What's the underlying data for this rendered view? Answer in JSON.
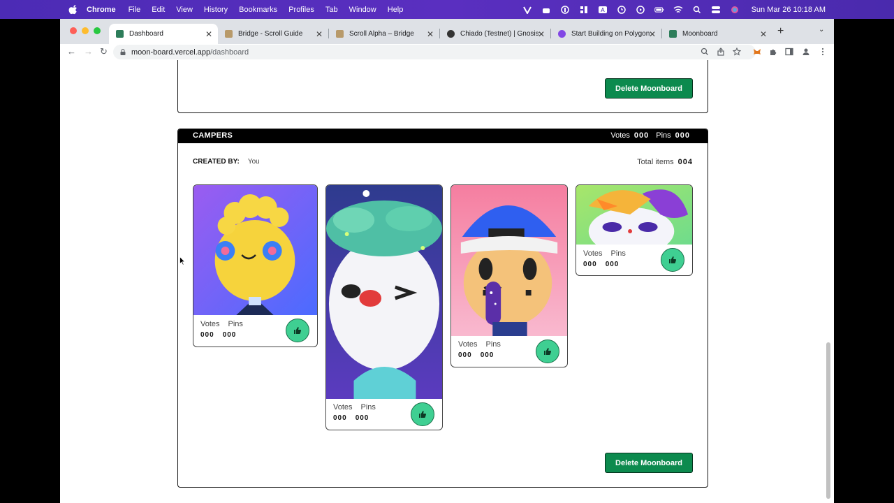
{
  "menubar": {
    "app": "Chrome",
    "items": [
      "File",
      "Edit",
      "View",
      "History",
      "Bookmarks",
      "Profiles",
      "Tab",
      "Window",
      "Help"
    ],
    "clock": "Sun Mar 26  10:18 AM"
  },
  "tabs": [
    {
      "label": "Dashboard",
      "favicon_color": "#2d7d5a"
    },
    {
      "label": "Bridge - Scroll Guide",
      "favicon_color": "#b89a6a"
    },
    {
      "label": "Scroll Alpha – Bridge",
      "favicon_color": "#b89a6a"
    },
    {
      "label": "Chiado (Testnet) | Gnosis C",
      "favicon_color": "#333333"
    },
    {
      "label": "Start Building on Polygon z",
      "favicon_color": "#8247e5"
    },
    {
      "label": "Moonboard",
      "favicon_color": "#2d7d5a"
    }
  ],
  "address": {
    "host": "moon-board.vercel.app",
    "path": "/dashboard"
  },
  "prev_board": {
    "delete_label": "Delete Moonboard"
  },
  "board": {
    "title": "CAMPERS",
    "votes_label": "Votes",
    "votes_value": "000",
    "pins_label": "Pins",
    "pins_value": "000",
    "created_label": "CREATED BY:",
    "created_value": "You",
    "total_label": "Total items",
    "total_value": "004",
    "delete_label": "Delete Moonboard",
    "cards": [
      {
        "votes_label": "Votes",
        "pins_label": "Pins",
        "votes": "000",
        "pins": "000"
      },
      {
        "votes_label": "Votes",
        "pins_label": "Pins",
        "votes": "000",
        "pins": "000"
      },
      {
        "votes_label": "Votes",
        "pins_label": "Pins",
        "votes": "000",
        "pins": "000"
      },
      {
        "votes_label": "Votes",
        "pins_label": "Pins",
        "votes": "000",
        "pins": "000"
      }
    ]
  },
  "colors": {
    "accent_green": "#0c8a4e",
    "like_green": "#3fcf92",
    "menubar": "#4c2bb5"
  }
}
